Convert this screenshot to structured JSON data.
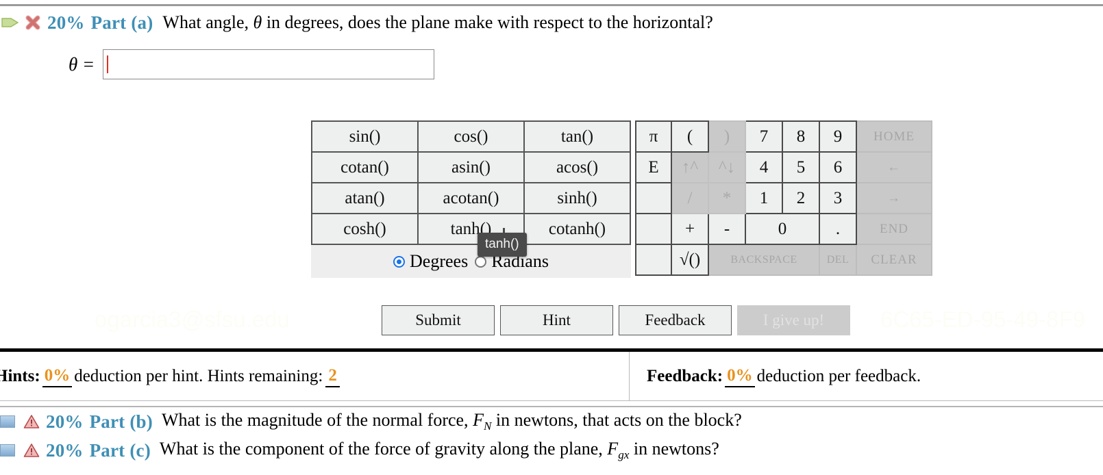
{
  "part_a": {
    "status_icons": [
      "green-arrow-icon",
      "red-x-icon"
    ],
    "percent": "20%",
    "part_label": "Part (a)",
    "question_prefix": "What angle, ",
    "question_symbol": "θ",
    "question_suffix": " in degrees, does the plane make with respect to the horizontal?",
    "answer_label": "θ =",
    "answer_value": "",
    "answer_placeholder": ""
  },
  "calculator": {
    "trig_rows": [
      [
        "sin()",
        "cos()",
        "tan()"
      ],
      [
        "cotan()",
        "asin()",
        "acos()"
      ],
      [
        "atan()",
        "acotan()",
        "sinh()"
      ],
      [
        "cosh()",
        "tanh()",
        "cotanh()"
      ]
    ],
    "mode": {
      "degrees_label": "Degrees",
      "radians_label": "Radians",
      "selected": "Degrees"
    },
    "tooltip": "tanh()",
    "keypad_rows": [
      [
        {
          "label": "π",
          "state": "normal",
          "w": "w-pi"
        },
        {
          "label": "(",
          "state": "normal",
          "w": "w-op"
        },
        {
          "label": ")",
          "state": "dim",
          "w": "w-op"
        },
        {
          "label": "7",
          "state": "normal",
          "w": "w-num"
        },
        {
          "label": "8",
          "state": "normal",
          "w": "w-num"
        },
        {
          "label": "9",
          "state": "normal",
          "w": "w-num"
        },
        {
          "label": "HOME",
          "state": "nav",
          "w": "w-nav"
        }
      ],
      [
        {
          "label": "E",
          "state": "normal",
          "w": "w-pi"
        },
        {
          "label": "↑^",
          "state": "dim",
          "w": "w-op"
        },
        {
          "label": "^↓",
          "state": "dim",
          "w": "w-op"
        },
        {
          "label": "4",
          "state": "normal",
          "w": "w-num"
        },
        {
          "label": "5",
          "state": "normal",
          "w": "w-num"
        },
        {
          "label": "6",
          "state": "normal",
          "w": "w-num"
        },
        {
          "label": "←",
          "state": "nav",
          "w": "w-nav"
        }
      ],
      [
        {
          "label": "",
          "state": "blank",
          "w": "w-pi"
        },
        {
          "label": "/",
          "state": "dim",
          "w": "w-op"
        },
        {
          "label": "*",
          "state": "dim",
          "w": "w-op"
        },
        {
          "label": "1",
          "state": "normal",
          "w": "w-num"
        },
        {
          "label": "2",
          "state": "normal",
          "w": "w-num"
        },
        {
          "label": "3",
          "state": "normal",
          "w": "w-num"
        },
        {
          "label": "→",
          "state": "nav",
          "w": "w-nav"
        }
      ],
      [
        {
          "label": "",
          "state": "blank",
          "w": "w-pi"
        },
        {
          "label": "+",
          "state": "normal",
          "w": "w-op"
        },
        {
          "label": "-",
          "state": "normal",
          "w": "w-op"
        },
        {
          "label": "0",
          "state": "normal",
          "w": "w-num",
          "colspan": 2
        },
        {
          "label": ".",
          "state": "normal",
          "w": "w-num"
        },
        {
          "label": "END",
          "state": "nav",
          "w": "w-nav"
        }
      ],
      [
        {
          "label": "",
          "state": "blank",
          "w": "w-pi"
        },
        {
          "label": "√()",
          "state": "normal",
          "w": "w-op"
        },
        {
          "label": "BACKSPACE",
          "state": "nav-small",
          "w": "w-num",
          "colspan": 3
        },
        {
          "label": "DEL",
          "state": "nav-small",
          "w": "w-num"
        },
        {
          "label": "CLEAR",
          "state": "nav",
          "w": "w-nav"
        }
      ]
    ]
  },
  "actions": {
    "submit": "Submit",
    "hint": "Hint",
    "feedback": "Feedback",
    "give_up": "I give up!"
  },
  "watermark": {
    "left": "ogarcia3@sfsu.edu",
    "right": "6C65-ED-95-49-8F9"
  },
  "hints_bar": {
    "hints_label": "Hints:",
    "hints_deduction": "0%",
    "hints_text": "deduction per hint. Hints remaining:",
    "hints_remaining": "2",
    "feedback_label": "Feedback:",
    "feedback_deduction": "0%",
    "feedback_text": "deduction per feedback."
  },
  "part_b": {
    "percent": "20%",
    "part_label": "Part (b)",
    "q_a": "What is the magnitude of the normal force, ",
    "q_sym": "F",
    "q_sub": "N",
    "q_b": " in newtons, that acts on the block?"
  },
  "part_c": {
    "percent": "20%",
    "part_label": "Part (c)",
    "q_a": "What is the component of the force of gravity along the plane, ",
    "q_sym": "F",
    "q_sub": "gx",
    "q_b": " in newtons?"
  },
  "colors": {
    "accent_blue": "#3f8fb5",
    "orange": "#e8921f",
    "key_face": "#eeefef",
    "key_dim": "#c9c9c9",
    "radio_blue": "#1a73e8"
  }
}
